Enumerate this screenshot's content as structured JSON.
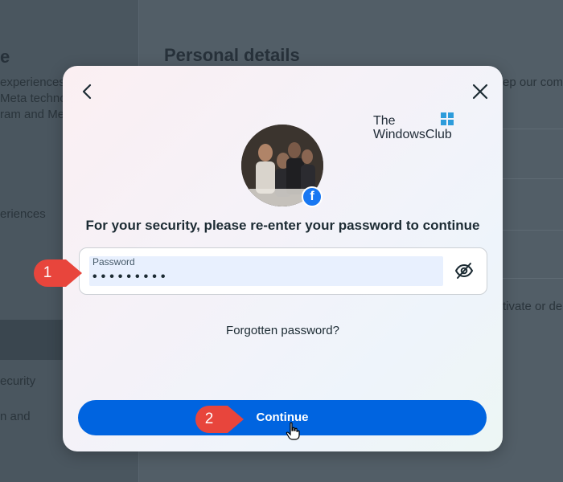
{
  "background": {
    "left_heading": "e",
    "left_lines": [
      "experiences",
      "Meta techno",
      "ram and Me"
    ],
    "left_item_1": "eriences",
    "left_item_2": "ecurity",
    "left_item_3": "n and",
    "main_heading": "Personal details",
    "right_snippet_1": "ep our com",
    "right_snippet_2": "tivate or de"
  },
  "watermark": {
    "line1": "The",
    "line2": "WindowsClub"
  },
  "dialog": {
    "back_icon": "chevron-left-icon",
    "close_icon": "close-icon",
    "badge_icon": "facebook-icon",
    "prompt": "For your security, please re-enter your password to continue",
    "password_label": "Password",
    "password_value": "•••••••••",
    "eye_icon": "eye-off-icon",
    "forgot_link": "Forgotten password?",
    "continue_label": "Continue"
  },
  "callouts": {
    "one": "1",
    "two": "2"
  },
  "colors": {
    "primary": "#0064e0",
    "callout": "#e8453c",
    "facebook": "#1877f2"
  }
}
